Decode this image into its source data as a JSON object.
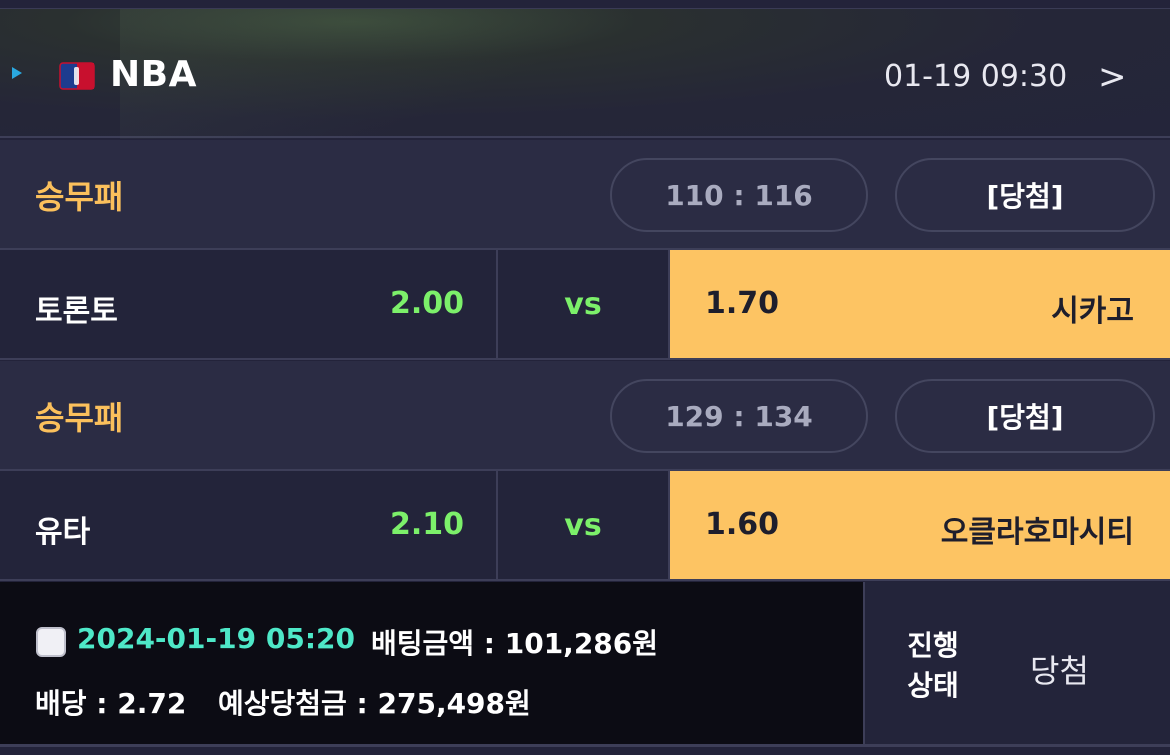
{
  "header": {
    "league": "NBA",
    "game_time": "01-19 09:30",
    "chevron": ">"
  },
  "games": [
    {
      "market": "승무패",
      "score": "110 : 116",
      "result": "[당첨]",
      "home_team": "토론토",
      "home_odds": "2.00",
      "vs_label": "vs",
      "away_odds": "1.70",
      "away_team": "시카고"
    },
    {
      "market": "승무패",
      "score": "129 : 134",
      "result": "[당첨]",
      "home_team": "유타",
      "home_odds": "2.10",
      "vs_label": "vs",
      "away_odds": "1.60",
      "away_team": "오클라호마시티"
    }
  ],
  "footer": {
    "bet_date": "2024-01-19 05:20",
    "bet_amount": "배팅금액 : 101,286원",
    "bet_odds": "배당 : 2.72",
    "expected_win": "예상당첨금 : 275,498원",
    "status_label": "진행 상태",
    "status_value": "당첨"
  },
  "colors": {
    "accent_gold": "#fbc05c",
    "odds_green": "#7cf06a",
    "selected_bg": "#fdc463",
    "date_cyan": "#4ee8c8"
  }
}
